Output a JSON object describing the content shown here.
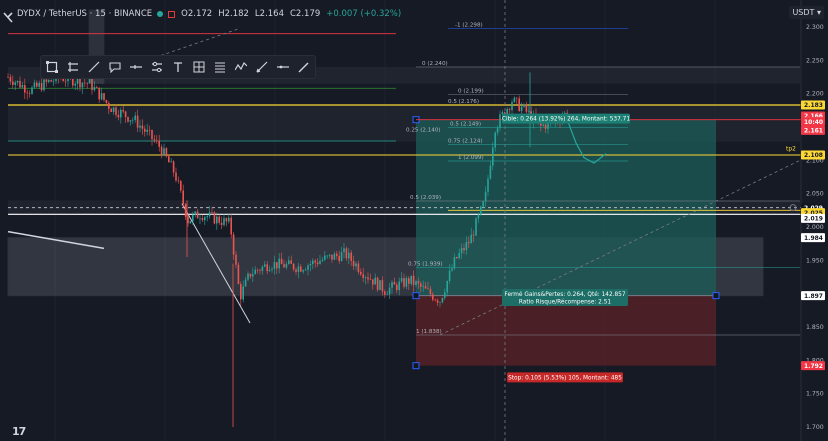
{
  "header": {
    "symbol": "DYDX / TetherUS · 15 · BINANCE",
    "o": "O2.172",
    "h": "H2.182",
    "l": "L2.164",
    "c": "C2.179",
    "chg": "+0.007 (+0.32%)"
  },
  "currency_button": "USDT ▾",
  "price_axis": {
    "ticks": [
      "2.300",
      "2.250",
      "2.200",
      "2.150",
      "2.100",
      "2.050",
      "2.000",
      "1.950",
      "1.900",
      "1.850",
      "1.800",
      "1.750",
      "1.700"
    ],
    "labels": [
      {
        "text": "2.183",
        "value": 2.183,
        "bg": "#fdd835",
        "fg": "#131722"
      },
      {
        "text": "2.166",
        "value": 2.1665,
        "bg": "#f23645",
        "fg": "#ffffff"
      },
      {
        "text": "10:40",
        "value": 2.158,
        "bg": "#f23645",
        "fg": "#ffffff"
      },
      {
        "text": "2.161",
        "value": 2.145,
        "bg": "#f23645",
        "fg": "#ffffff"
      },
      {
        "text": "2.108",
        "value": 2.108,
        "bg": "#fdd835",
        "fg": "#131722"
      },
      {
        "text": "2.029",
        "value": 2.029,
        "bg": "#131722",
        "fg": "#ffffff"
      },
      {
        "text": "2.025",
        "value": 2.0215,
        "bg": "#fdd835",
        "fg": "#131722"
      },
      {
        "text": "2.019",
        "value": 2.013,
        "bg": "#ffffff",
        "fg": "#131722"
      },
      {
        "text": "1.984",
        "value": 1.984,
        "bg": "#ffffff",
        "fg": "#131722"
      },
      {
        "text": "1.897",
        "value": 1.897,
        "bg": "#ffffff",
        "fg": "#131722"
      },
      {
        "text": "1.792",
        "value": 1.792,
        "bg": "#f23645",
        "fg": "#ffffff"
      }
    ]
  },
  "fib_labels": [
    {
      "text": "-1 (2.298)",
      "value": 2.298
    },
    {
      "text": "0 (2.240)",
      "value": 2.24
    },
    {
      "text": "0 (2.199)",
      "value": 2.199
    },
    {
      "text": "0.5 (2.176)",
      "value": 2.183
    },
    {
      "text": "0.25 (2.140)",
      "value": 2.14
    },
    {
      "text": "0.5 (2.149)",
      "value": 2.149
    },
    {
      "text": "0.75 (2.124)",
      "value": 2.124
    },
    {
      "text": "1 (2.099)",
      "value": 2.099
    },
    {
      "text": "0.5 (2.039)",
      "value": 2.039
    },
    {
      "text": "0.75 (1.939)",
      "value": 1.939
    },
    {
      "text": "1 (1.838)",
      "value": 1.838
    }
  ],
  "target_box": "Cible: 0.264 (13.92%) 264, Montant: 537.71",
  "pnl_box": {
    "line1": "Fermé Gains&Pertes: 0.264, Qté: 142.857",
    "line2": "Ratio Risque/Récompense: 2.51"
  },
  "stop_box": "Stop: 0.105 (5.53%) 105, Montant: 485",
  "tp2_label": "tp2",
  "colors": {
    "up": "#26a69a",
    "down": "#ef5350",
    "yellow": "#fdd835",
    "profit_zone": "#1d5e59",
    "loss_zone": "#5c2226"
  },
  "toolbar_icons": [
    "select-box-icon",
    "rectangle-icon",
    "trend-line-icon",
    "text-note-icon",
    "arrow-line-icon",
    "sliders-icon",
    "text-tool-icon",
    "grid-icon",
    "list-icon",
    "wave-icon",
    "brush-icon",
    "horizontal-line-icon",
    "pencil-icon"
  ],
  "tv_logo": "17"
}
